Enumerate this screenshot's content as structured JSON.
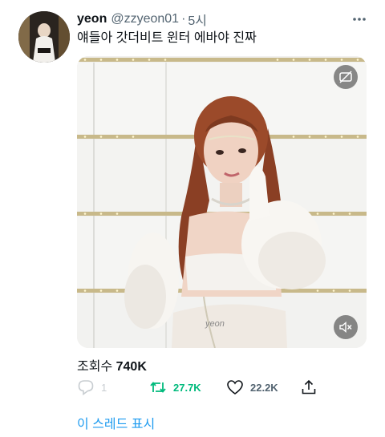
{
  "user": {
    "display_name": "yeon",
    "handle": "@zzyeon01",
    "separator": "·",
    "time": "5시"
  },
  "tweet": {
    "text": "얘들아 갓더비트 윈터 에바야 진짜",
    "watermark": "yeon"
  },
  "stats": {
    "views_label": "조회수",
    "views_count": "740K",
    "reply_count": "1",
    "retweet_count": "27.7K",
    "like_count": "22.2K"
  },
  "footer": {
    "show_thread": "이 스레드 표시"
  },
  "icons": {
    "more": "more-horizontal-icon",
    "captions": "captions-off-icon",
    "mute": "speaker-muted-icon",
    "reply": "reply-bubble-icon",
    "retweet": "retweet-icon",
    "like": "heart-icon",
    "share": "share-icon"
  },
  "colors": {
    "link": "#1d9bf0",
    "retweeted": "#00ba7c",
    "secondary_text": "#536471"
  }
}
